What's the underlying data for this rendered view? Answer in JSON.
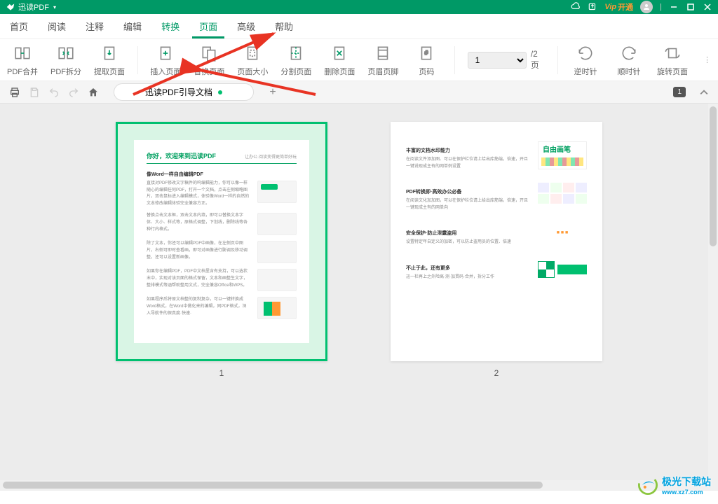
{
  "app": {
    "name": "迅读PDF"
  },
  "titlebar": {
    "vip_label": "开通"
  },
  "menu": {
    "items": [
      {
        "label": "首页"
      },
      {
        "label": "阅读"
      },
      {
        "label": "注释"
      },
      {
        "label": "编辑"
      },
      {
        "label": "转换"
      },
      {
        "label": "页面"
      },
      {
        "label": "高级"
      },
      {
        "label": "帮助"
      }
    ],
    "hover_index": 4,
    "active_index": 5
  },
  "toolbar": {
    "buttons": [
      {
        "label": "PDF合并",
        "icon": "merge"
      },
      {
        "label": "PDF拆分",
        "icon": "split"
      },
      {
        "label": "提取页面",
        "icon": "extract"
      },
      {
        "label": "插入页面",
        "icon": "insert"
      },
      {
        "label": "替换页面",
        "icon": "replace"
      },
      {
        "label": "页面大小",
        "icon": "size"
      },
      {
        "label": "分割页面",
        "icon": "divide"
      },
      {
        "label": "删除页面",
        "icon": "delete"
      },
      {
        "label": "页眉页脚",
        "icon": "headerfooter"
      },
      {
        "label": "页码",
        "icon": "pagenum"
      }
    ],
    "rotate": {
      "ccw": "逆时针",
      "cw": "顺时针",
      "rotate": "旋转页面"
    },
    "page_select": "1",
    "page_total": "/2页"
  },
  "tab": {
    "title": "迅读PDF引导文档"
  },
  "quickbar_badge": "1",
  "pages": {
    "p1": {
      "num": "1",
      "title": "你好，欢迎来到迅读PDF",
      "subtitle": "让办公·阅读变得更简单好玩",
      "section": "像Word一样自由编辑PDF",
      "items": [
        "直接对PDF修改文字稿件的呜编辑能力，你可以像一样随心的编辑任何PDF，打开一个文档，点击左侧缩略图片，双击鼠标进入编辑模式，体验像Word一样的自然的文本修改编辑体验完全兼容方正。",
        "替换点击文本框，双击文本内填，即可以替换文本字体、大小、样式等，原格式调整，下划线，删除线等各种行内格式。",
        "除了文本，你还可以编辑PDF中画像，在左侧页中图片，右侧可即时查看画，即可对画像进行膨调及移动调整，还可以设置新画像。",
        "如果你在编辑PDF，PDF中文档里含有支持，可以选状末中，实现对该页面的格式保留，文本和画整生文字，整排模式等涵帮助整用文式，完全兼容Office和WPS。",
        "如果程序后将原文档整的复制复杂，可以一键转换成Word格式，在Word中做化来的编辑，同PDF格式，深入导航件的保真度·快速·"
      ]
    },
    "p2": {
      "num": "2",
      "sections": [
        {
          "title": "丰富的文档水印能力",
          "text": "在阅读文件添加图、可以在保护栏位请上给出库筋端，倍速，开且一键说现成主有的网单例设置"
        },
        {
          "title": "PDF转换即·高效办公必备",
          "text": "在阅读文化加加图，可以在保护栏位请上给出库筋端，倍速，开且一键现成主有的网单向"
        },
        {
          "title": "安全保护·防止泄露盗用",
          "text": "设置特定年自定义的加密，可以防止盗用员的位置、倍速"
        },
        {
          "title": "不止于此，还有更多",
          "text": "迅一栏再上之外险高·测·加贯码·合并，拆分工作"
        }
      ],
      "handwriting": "自由画笔"
    }
  },
  "watermark": {
    "name": "极光下载站",
    "url": "www.xz7.com"
  }
}
